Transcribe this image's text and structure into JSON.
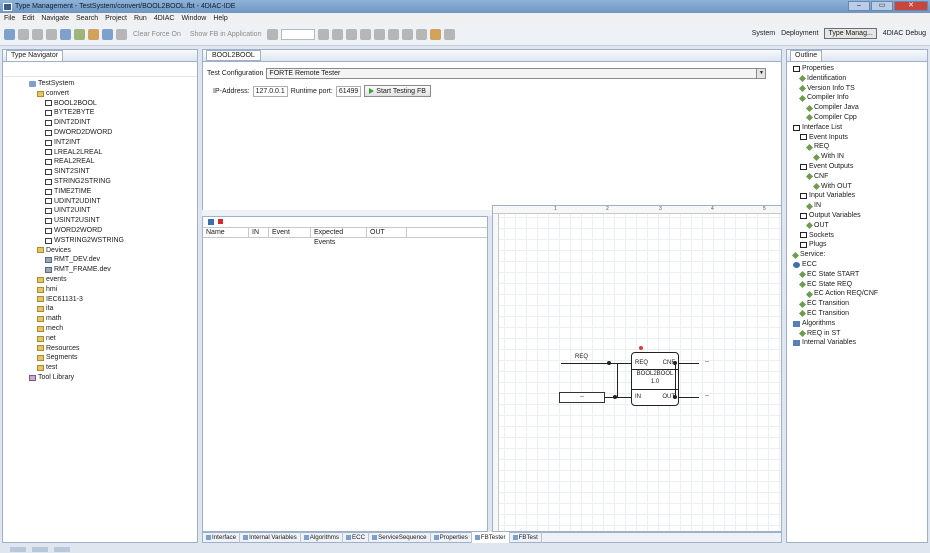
{
  "window": {
    "title": "Type Management - TestSystem/convert/BOOL2BOOL.fbt - 4DIAC-IDE",
    "buttons": {
      "minimize": "–",
      "maximize": "▭",
      "close": "✕"
    }
  },
  "menu": [
    "File",
    "Edit",
    "Navigate",
    "Search",
    "Project",
    "Run",
    "4DIAC",
    "Window",
    "Help"
  ],
  "toolbar": {
    "clear_force": "Clear Force On",
    "show_fb": "Show FB in Application"
  },
  "perspectives": {
    "system": "System",
    "deployment": "Deployment",
    "type_management": "Type Manag...",
    "debug": "4DIAC Debug"
  },
  "type_navigator": {
    "tab": "Type Navigator",
    "items": [
      {
        "label": "TestSystem",
        "indent": 0,
        "icon": "sys"
      },
      {
        "label": "convert",
        "indent": 1,
        "icon": "folder"
      },
      {
        "label": "BOOL2BOOL",
        "indent": 2,
        "icon": "fb"
      },
      {
        "label": "BYTE2BYTE",
        "indent": 2,
        "icon": "fb"
      },
      {
        "label": "DINT2DINT",
        "indent": 2,
        "icon": "fb"
      },
      {
        "label": "DWORD2DWORD",
        "indent": 2,
        "icon": "fb"
      },
      {
        "label": "INT2INT",
        "indent": 2,
        "icon": "fb"
      },
      {
        "label": "LREAL2LREAL",
        "indent": 2,
        "icon": "fb"
      },
      {
        "label": "REAL2REAL",
        "indent": 2,
        "icon": "fb"
      },
      {
        "label": "SINT2SINT",
        "indent": 2,
        "icon": "fb"
      },
      {
        "label": "STRING2STRING",
        "indent": 2,
        "icon": "fb"
      },
      {
        "label": "TIME2TIME",
        "indent": 2,
        "icon": "fb"
      },
      {
        "label": "UDINT2UDINT",
        "indent": 2,
        "icon": "fb"
      },
      {
        "label": "UINT2UINT",
        "indent": 2,
        "icon": "fb"
      },
      {
        "label": "USINT2USINT",
        "indent": 2,
        "icon": "fb"
      },
      {
        "label": "WORD2WORD",
        "indent": 2,
        "icon": "fb"
      },
      {
        "label": "WSTRING2WSTRING",
        "indent": 2,
        "icon": "fb"
      },
      {
        "label": "Devices",
        "indent": 1,
        "icon": "folder"
      },
      {
        "label": "RMT_DEV.dev",
        "indent": 2,
        "icon": "dev"
      },
      {
        "label": "RMT_FRAME.dev",
        "indent": 2,
        "icon": "dev"
      },
      {
        "label": "events",
        "indent": 1,
        "icon": "folder"
      },
      {
        "label": "hmi",
        "indent": 1,
        "icon": "folder"
      },
      {
        "label": "IEC61131-3",
        "indent": 1,
        "icon": "folder"
      },
      {
        "label": "ita",
        "indent": 1,
        "icon": "folder"
      },
      {
        "label": "math",
        "indent": 1,
        "icon": "folder"
      },
      {
        "label": "mech",
        "indent": 1,
        "icon": "folder"
      },
      {
        "label": "net",
        "indent": 1,
        "icon": "folder"
      },
      {
        "label": "Resources",
        "indent": 1,
        "icon": "folder"
      },
      {
        "label": "Segments",
        "indent": 1,
        "icon": "folder"
      },
      {
        "label": "test",
        "indent": 1,
        "icon": "folder"
      },
      {
        "label": "Tool Library",
        "indent": 0,
        "icon": "lib"
      }
    ]
  },
  "editor": {
    "tab": "BOOL2BOOL",
    "test_config_label": "Test Configuration",
    "test_config_value": "FORTE Remote Tester",
    "ip_label": "IP-Address:",
    "ip_value": "127.0.0.1",
    "port_label": "Runtime port:",
    "port_value": "61499",
    "start_button": "Start Testing FB"
  },
  "test_table": {
    "columns": [
      "Name",
      "IN",
      "Event",
      "Expected Events",
      "OUT"
    ]
  },
  "fb_diagram": {
    "ruler_marks": [
      "1",
      "2",
      "3",
      "4",
      "5"
    ],
    "block_name": "BOOL2BOOL",
    "block_version": "1.0",
    "event_in": "REQ",
    "event_out": "CNF",
    "data_in": "IN",
    "data_out": "OUT",
    "req_input_label": "REQ",
    "in_value": "--",
    "cnf_value": "--",
    "out_value": "--"
  },
  "bottom_tabs": [
    {
      "label": "Interface",
      "active": false
    },
    {
      "label": "Internal Variables",
      "active": false
    },
    {
      "label": "Algorithms",
      "active": false
    },
    {
      "label": "ECC",
      "active": false
    },
    {
      "label": "ServiceSequence",
      "active": false
    },
    {
      "label": "Properties",
      "active": false
    },
    {
      "label": "FBTester",
      "active": true
    },
    {
      "label": "FBTest",
      "active": false
    }
  ],
  "outline": {
    "tab": "Outline",
    "items": [
      {
        "label": "Properties",
        "indent": 0,
        "icon": "box"
      },
      {
        "label": "Identification",
        "indent": 1,
        "icon": "diamond"
      },
      {
        "label": "Version Info TS",
        "indent": 1,
        "icon": "diamond"
      },
      {
        "label": "Compiler Info",
        "indent": 1,
        "icon": "diamond"
      },
      {
        "label": "Compiler Java",
        "indent": 2,
        "icon": "diamond"
      },
      {
        "label": "Compiler Cpp",
        "indent": 2,
        "icon": "diamond"
      },
      {
        "label": "Interface List",
        "indent": 0,
        "icon": "box"
      },
      {
        "label": "Event Inputs",
        "indent": 1,
        "icon": "box"
      },
      {
        "label": "REQ",
        "indent": 2,
        "icon": "diamond"
      },
      {
        "label": "With IN",
        "indent": 3,
        "icon": "diamond"
      },
      {
        "label": "Event Outputs",
        "indent": 1,
        "icon": "box"
      },
      {
        "label": "CNF",
        "indent": 2,
        "icon": "diamond"
      },
      {
        "label": "With OUT",
        "indent": 3,
        "icon": "diamond"
      },
      {
        "label": "Input Variables",
        "indent": 1,
        "icon": "box"
      },
      {
        "label": "IN",
        "indent": 2,
        "icon": "diamond"
      },
      {
        "label": "Output Variables",
        "indent": 1,
        "icon": "box"
      },
      {
        "label": "OUT",
        "indent": 2,
        "icon": "diamond"
      },
      {
        "label": "Sockets",
        "indent": 1,
        "icon": "box"
      },
      {
        "label": "Plugs",
        "indent": 1,
        "icon": "box"
      },
      {
        "label": "Service:",
        "indent": 0,
        "icon": "diamond"
      },
      {
        "label": "ECC",
        "indent": 0,
        "icon": "ecc"
      },
      {
        "label": "EC State START",
        "indent": 1,
        "icon": "diamond"
      },
      {
        "label": "EC State REQ",
        "indent": 1,
        "icon": "diamond"
      },
      {
        "label": "EC Action REQ/CNF",
        "indent": 2,
        "icon": "diamond"
      },
      {
        "label": "EC Transition",
        "indent": 1,
        "icon": "diamond"
      },
      {
        "label": "EC Transition",
        "indent": 1,
        "icon": "diamond"
      },
      {
        "label": "Algorithms",
        "indent": 0,
        "icon": "alg"
      },
      {
        "label": "REQ in ST",
        "indent": 1,
        "icon": "diamond"
      },
      {
        "label": "Internal Variables",
        "indent": 0,
        "icon": "alg"
      }
    ]
  }
}
